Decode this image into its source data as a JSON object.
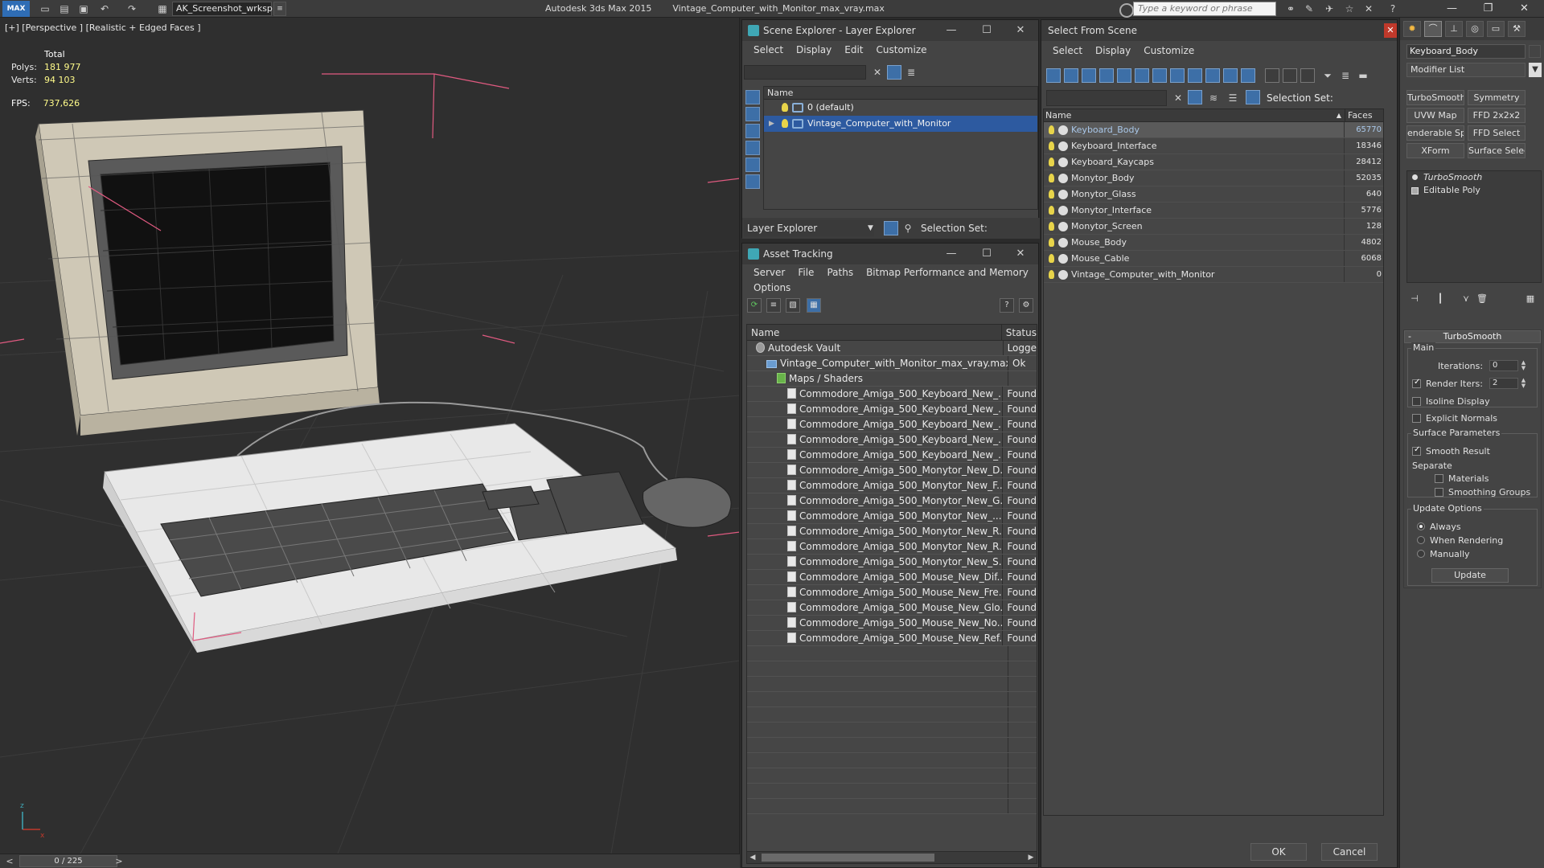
{
  "titlebar": {
    "logo": "MAX",
    "workspace": "AK_Screenshot_wrksp",
    "app_name": "Autodesk 3ds Max  2015",
    "file_name": "Vintage_Computer_with_Monitor_max_vray.max",
    "search_placeholder": "Type a keyword or phrase"
  },
  "viewport": {
    "label": "[+] [Perspective ] [Realistic + Edged Faces ]",
    "stats": {
      "total_label": "Total",
      "polys_label": "Polys:",
      "polys": "181 977",
      "verts_label": "Verts:",
      "verts": "94 103",
      "fps_label": "FPS:",
      "fps": "737,626"
    },
    "axis_x": "x",
    "axis_z": "z"
  },
  "timeline": {
    "frame": "0 / 225",
    "prev": "<",
    "next": ">"
  },
  "scene_explorer": {
    "title": "Scene Explorer - Layer Explorer",
    "menu": [
      "Select",
      "Display",
      "Edit",
      "Customize"
    ],
    "column": "Name",
    "layers": [
      {
        "name": "0 (default)",
        "selected": false
      },
      {
        "name": "Vintage_Computer_with_Monitor",
        "selected": true
      }
    ],
    "explorer_type": "Layer Explorer",
    "selection_set": "Selection Set:"
  },
  "asset_tracking": {
    "title": "Asset Tracking",
    "menu": [
      "Server",
      "File",
      "Paths",
      "Bitmap Performance and Memory"
    ],
    "menu2": "Options",
    "columns": {
      "name": "Name",
      "status": "Status"
    },
    "rows": [
      {
        "name": "Autodesk Vault",
        "status": "Logge",
        "indent": 1,
        "icon": "vault"
      },
      {
        "name": "Vintage_Computer_with_Monitor_max_vray.max",
        "status": "Ok",
        "indent": 2,
        "icon": "file"
      },
      {
        "name": "Maps / Shaders",
        "status": "",
        "indent": 3,
        "icon": "maps"
      },
      {
        "name": "Commodore_Amiga_500_Keyboard_New_...",
        "status": "Found",
        "indent": 4,
        "icon": "bitmap"
      },
      {
        "name": "Commodore_Amiga_500_Keyboard_New_...",
        "status": "Found",
        "indent": 4,
        "icon": "bitmap"
      },
      {
        "name": "Commodore_Amiga_500_Keyboard_New_...",
        "status": "Found",
        "indent": 4,
        "icon": "bitmap"
      },
      {
        "name": "Commodore_Amiga_500_Keyboard_New_...",
        "status": "Found",
        "indent": 4,
        "icon": "bitmap"
      },
      {
        "name": "Commodore_Amiga_500_Keyboard_New_...",
        "status": "Found",
        "indent": 4,
        "icon": "bitmap"
      },
      {
        "name": "Commodore_Amiga_500_Monytor_New_D...",
        "status": "Found",
        "indent": 4,
        "icon": "bitmap"
      },
      {
        "name": "Commodore_Amiga_500_Monytor_New_F...",
        "status": "Found",
        "indent": 4,
        "icon": "bitmap"
      },
      {
        "name": "Commodore_Amiga_500_Monytor_New_G...",
        "status": "Found",
        "indent": 4,
        "icon": "bitmap"
      },
      {
        "name": "Commodore_Amiga_500_Monytor_New_...",
        "status": "Found",
        "indent": 4,
        "icon": "bitmap"
      },
      {
        "name": "Commodore_Amiga_500_Monytor_New_R...",
        "status": "Found",
        "indent": 4,
        "icon": "bitmap"
      },
      {
        "name": "Commodore_Amiga_500_Monytor_New_R...",
        "status": "Found",
        "indent": 4,
        "icon": "bitmap"
      },
      {
        "name": "Commodore_Amiga_500_Monytor_New_S...",
        "status": "Found",
        "indent": 4,
        "icon": "bitmap"
      },
      {
        "name": "Commodore_Amiga_500_Mouse_New_Dif...",
        "status": "Found",
        "indent": 4,
        "icon": "bitmap"
      },
      {
        "name": "Commodore_Amiga_500_Mouse_New_Fre...",
        "status": "Found",
        "indent": 4,
        "icon": "bitmap"
      },
      {
        "name": "Commodore_Amiga_500_Mouse_New_Glo...",
        "status": "Found",
        "indent": 4,
        "icon": "bitmap"
      },
      {
        "name": "Commodore_Amiga_500_Mouse_New_No...",
        "status": "Found",
        "indent": 4,
        "icon": "bitmap"
      },
      {
        "name": "Commodore_Amiga_500_Mouse_New_Ref...",
        "status": "Found",
        "indent": 4,
        "icon": "bitmap"
      }
    ]
  },
  "select_from_scene": {
    "title": "Select From Scene",
    "menu": [
      "Select",
      "Display",
      "Customize"
    ],
    "selection_set": "Selection Set:",
    "columns": {
      "name": "Name",
      "faces": "Faces"
    },
    "rows": [
      {
        "name": "Keyboard_Body",
        "faces": "65770",
        "selected": true
      },
      {
        "name": "Keyboard_Interface",
        "faces": "18346",
        "selected": false
      },
      {
        "name": "Keyboard_Kaycaps",
        "faces": "28412",
        "selected": false
      },
      {
        "name": "Monytor_Body",
        "faces": "52035",
        "selected": false
      },
      {
        "name": "Monytor_Glass",
        "faces": "640",
        "selected": false
      },
      {
        "name": "Monytor_Interface",
        "faces": "5776",
        "selected": false
      },
      {
        "name": "Monytor_Screen",
        "faces": "128",
        "selected": false
      },
      {
        "name": "Mouse_Body",
        "faces": "4802",
        "selected": false
      },
      {
        "name": "Mouse_Cable",
        "faces": "6068",
        "selected": false
      },
      {
        "name": "Vintage_Computer_with_Monitor",
        "faces": "0",
        "selected": false
      }
    ],
    "ok": "OK",
    "cancel": "Cancel"
  },
  "command_panel": {
    "object_name": "Keyboard_Body",
    "modifier_list": "Modifier List",
    "mod_buttons": [
      "TurboSmooth",
      "Symmetry",
      "UVW Map",
      "FFD 2x2x2",
      "enderable Splin",
      "FFD Select",
      "XForm",
      "Surface Select"
    ],
    "stack": [
      {
        "name": "TurboSmooth",
        "italic": true
      },
      {
        "name": "Editable Poly",
        "italic": false
      }
    ],
    "rollout": {
      "title": "TurboSmooth",
      "main": "Main",
      "iterations_label": "Iterations:",
      "iterations": "0",
      "render_iters_label": "Render Iters:",
      "render_iters": "2",
      "isoline": "Isoline Display",
      "explicit_normals": "Explicit Normals",
      "surface_params": "Surface Parameters",
      "smooth_result": "Smooth Result",
      "separate": "Separate",
      "materials": "Materials",
      "smoothing_groups": "Smoothing Groups",
      "update_options": "Update Options",
      "always": "Always",
      "when_rendering": "When Rendering",
      "manually": "Manually",
      "update": "Update"
    }
  },
  "colors": {
    "selection_blue": "#2d5aa0",
    "accent": "#3d6fa7",
    "found_status": "#e8e8e8"
  }
}
